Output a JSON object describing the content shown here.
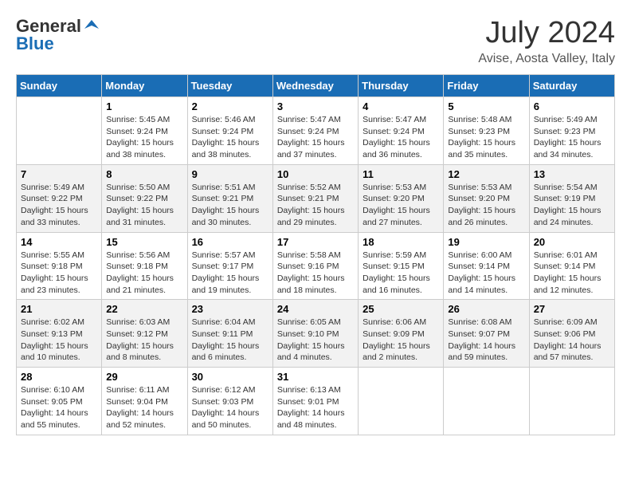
{
  "header": {
    "logo_general": "General",
    "logo_blue": "Blue",
    "month_year": "July 2024",
    "location": "Avise, Aosta Valley, Italy"
  },
  "days_of_week": [
    "Sunday",
    "Monday",
    "Tuesday",
    "Wednesday",
    "Thursday",
    "Friday",
    "Saturday"
  ],
  "weeks": [
    [
      {
        "day": "",
        "sunrise": "",
        "sunset": "",
        "daylight": ""
      },
      {
        "day": "1",
        "sunrise": "Sunrise: 5:45 AM",
        "sunset": "Sunset: 9:24 PM",
        "daylight": "Daylight: 15 hours and 38 minutes."
      },
      {
        "day": "2",
        "sunrise": "Sunrise: 5:46 AM",
        "sunset": "Sunset: 9:24 PM",
        "daylight": "Daylight: 15 hours and 38 minutes."
      },
      {
        "day": "3",
        "sunrise": "Sunrise: 5:47 AM",
        "sunset": "Sunset: 9:24 PM",
        "daylight": "Daylight: 15 hours and 37 minutes."
      },
      {
        "day": "4",
        "sunrise": "Sunrise: 5:47 AM",
        "sunset": "Sunset: 9:24 PM",
        "daylight": "Daylight: 15 hours and 36 minutes."
      },
      {
        "day": "5",
        "sunrise": "Sunrise: 5:48 AM",
        "sunset": "Sunset: 9:23 PM",
        "daylight": "Daylight: 15 hours and 35 minutes."
      },
      {
        "day": "6",
        "sunrise": "Sunrise: 5:49 AM",
        "sunset": "Sunset: 9:23 PM",
        "daylight": "Daylight: 15 hours and 34 minutes."
      }
    ],
    [
      {
        "day": "7",
        "sunrise": "Sunrise: 5:49 AM",
        "sunset": "Sunset: 9:22 PM",
        "daylight": "Daylight: 15 hours and 33 minutes."
      },
      {
        "day": "8",
        "sunrise": "Sunrise: 5:50 AM",
        "sunset": "Sunset: 9:22 PM",
        "daylight": "Daylight: 15 hours and 31 minutes."
      },
      {
        "day": "9",
        "sunrise": "Sunrise: 5:51 AM",
        "sunset": "Sunset: 9:21 PM",
        "daylight": "Daylight: 15 hours and 30 minutes."
      },
      {
        "day": "10",
        "sunrise": "Sunrise: 5:52 AM",
        "sunset": "Sunset: 9:21 PM",
        "daylight": "Daylight: 15 hours and 29 minutes."
      },
      {
        "day": "11",
        "sunrise": "Sunrise: 5:53 AM",
        "sunset": "Sunset: 9:20 PM",
        "daylight": "Daylight: 15 hours and 27 minutes."
      },
      {
        "day": "12",
        "sunrise": "Sunrise: 5:53 AM",
        "sunset": "Sunset: 9:20 PM",
        "daylight": "Daylight: 15 hours and 26 minutes."
      },
      {
        "day": "13",
        "sunrise": "Sunrise: 5:54 AM",
        "sunset": "Sunset: 9:19 PM",
        "daylight": "Daylight: 15 hours and 24 minutes."
      }
    ],
    [
      {
        "day": "14",
        "sunrise": "Sunrise: 5:55 AM",
        "sunset": "Sunset: 9:18 PM",
        "daylight": "Daylight: 15 hours and 23 minutes."
      },
      {
        "day": "15",
        "sunrise": "Sunrise: 5:56 AM",
        "sunset": "Sunset: 9:18 PM",
        "daylight": "Daylight: 15 hours and 21 minutes."
      },
      {
        "day": "16",
        "sunrise": "Sunrise: 5:57 AM",
        "sunset": "Sunset: 9:17 PM",
        "daylight": "Daylight: 15 hours and 19 minutes."
      },
      {
        "day": "17",
        "sunrise": "Sunrise: 5:58 AM",
        "sunset": "Sunset: 9:16 PM",
        "daylight": "Daylight: 15 hours and 18 minutes."
      },
      {
        "day": "18",
        "sunrise": "Sunrise: 5:59 AM",
        "sunset": "Sunset: 9:15 PM",
        "daylight": "Daylight: 15 hours and 16 minutes."
      },
      {
        "day": "19",
        "sunrise": "Sunrise: 6:00 AM",
        "sunset": "Sunset: 9:14 PM",
        "daylight": "Daylight: 15 hours and 14 minutes."
      },
      {
        "day": "20",
        "sunrise": "Sunrise: 6:01 AM",
        "sunset": "Sunset: 9:14 PM",
        "daylight": "Daylight: 15 hours and 12 minutes."
      }
    ],
    [
      {
        "day": "21",
        "sunrise": "Sunrise: 6:02 AM",
        "sunset": "Sunset: 9:13 PM",
        "daylight": "Daylight: 15 hours and 10 minutes."
      },
      {
        "day": "22",
        "sunrise": "Sunrise: 6:03 AM",
        "sunset": "Sunset: 9:12 PM",
        "daylight": "Daylight: 15 hours and 8 minutes."
      },
      {
        "day": "23",
        "sunrise": "Sunrise: 6:04 AM",
        "sunset": "Sunset: 9:11 PM",
        "daylight": "Daylight: 15 hours and 6 minutes."
      },
      {
        "day": "24",
        "sunrise": "Sunrise: 6:05 AM",
        "sunset": "Sunset: 9:10 PM",
        "daylight": "Daylight: 15 hours and 4 minutes."
      },
      {
        "day": "25",
        "sunrise": "Sunrise: 6:06 AM",
        "sunset": "Sunset: 9:09 PM",
        "daylight": "Daylight: 15 hours and 2 minutes."
      },
      {
        "day": "26",
        "sunrise": "Sunrise: 6:08 AM",
        "sunset": "Sunset: 9:07 PM",
        "daylight": "Daylight: 14 hours and 59 minutes."
      },
      {
        "day": "27",
        "sunrise": "Sunrise: 6:09 AM",
        "sunset": "Sunset: 9:06 PM",
        "daylight": "Daylight: 14 hours and 57 minutes."
      }
    ],
    [
      {
        "day": "28",
        "sunrise": "Sunrise: 6:10 AM",
        "sunset": "Sunset: 9:05 PM",
        "daylight": "Daylight: 14 hours and 55 minutes."
      },
      {
        "day": "29",
        "sunrise": "Sunrise: 6:11 AM",
        "sunset": "Sunset: 9:04 PM",
        "daylight": "Daylight: 14 hours and 52 minutes."
      },
      {
        "day": "30",
        "sunrise": "Sunrise: 6:12 AM",
        "sunset": "Sunset: 9:03 PM",
        "daylight": "Daylight: 14 hours and 50 minutes."
      },
      {
        "day": "31",
        "sunrise": "Sunrise: 6:13 AM",
        "sunset": "Sunset: 9:01 PM",
        "daylight": "Daylight: 14 hours and 48 minutes."
      },
      {
        "day": "",
        "sunrise": "",
        "sunset": "",
        "daylight": ""
      },
      {
        "day": "",
        "sunrise": "",
        "sunset": "",
        "daylight": ""
      },
      {
        "day": "",
        "sunrise": "",
        "sunset": "",
        "daylight": ""
      }
    ]
  ]
}
